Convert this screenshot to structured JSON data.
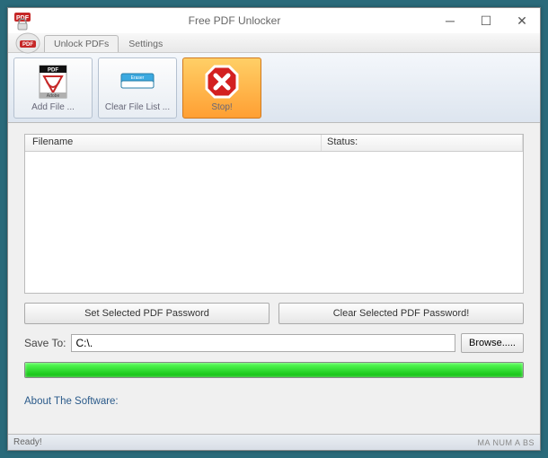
{
  "title": "Free PDF Unlocker",
  "tabs": {
    "unlock": "Unlock PDFs",
    "settings": "Settings"
  },
  "toolbar": {
    "add_file": "Add File ...",
    "clear_list": "Clear File List ...",
    "stop": "Stop!"
  },
  "list": {
    "col_filename": "Filename",
    "col_status": "Status:"
  },
  "buttons": {
    "set_pwd": "Set Selected PDF Password",
    "clear_pwd": "Clear Selected PDF Password!",
    "browse": "Browse....."
  },
  "save": {
    "label": "Save To:",
    "value": "C:\\."
  },
  "about": "About The Software:",
  "status": {
    "ready": "Ready!",
    "ind": "MA NUM A BS"
  }
}
